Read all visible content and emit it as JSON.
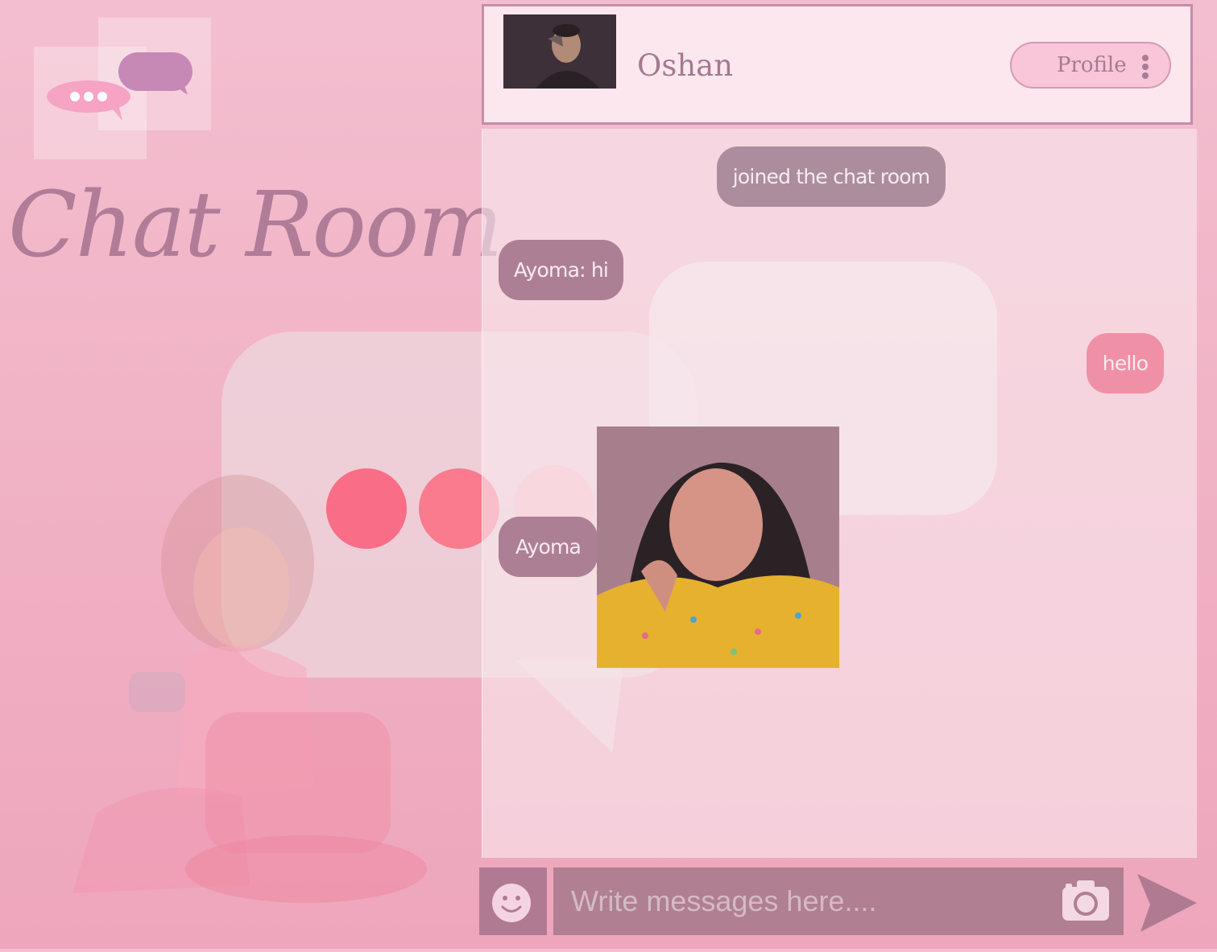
{
  "brand": {
    "title": "Chat Room"
  },
  "header": {
    "contact_name": "Oshan",
    "profile_button_label": "Profile"
  },
  "messages": [
    {
      "type": "system",
      "text": "joined the chat room"
    },
    {
      "type": "incoming",
      "text": "Ayoma: hi"
    },
    {
      "type": "outgoing",
      "text": "hello"
    },
    {
      "type": "incoming",
      "text": "Ayoma"
    }
  ],
  "composer": {
    "placeholder": "Write messages here...."
  },
  "icons": {
    "logo": "chat-bubbles-icon",
    "menu": "kebab-menu-icon",
    "emoji": "smiley-icon",
    "camera": "camera-icon",
    "send": "send-icon"
  },
  "colors": {
    "background": "#f1b3c6",
    "header_border": "#c68ca9",
    "incoming_bubble": "#ad7f95",
    "outgoing_bubble": "#f090a6",
    "system_bubble": "#ac8d9d",
    "composer": "#b07f91"
  }
}
